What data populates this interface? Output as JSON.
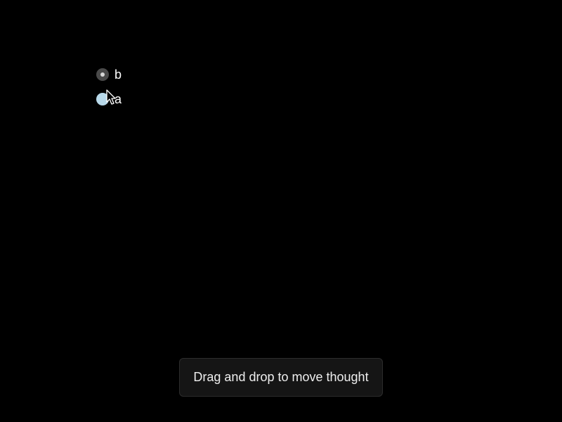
{
  "thoughts": [
    {
      "label": "b",
      "state": "default"
    },
    {
      "label": "a",
      "state": "dragging"
    }
  ],
  "toast": {
    "message": "Drag and drop to move thought"
  },
  "colors": {
    "background": "#000000",
    "bullet_default": "#4a4a4a",
    "bullet_active": "#b8d9ea",
    "toast_background": "#151515"
  },
  "icons": {
    "cursor": "arrow-cursor-icon"
  }
}
